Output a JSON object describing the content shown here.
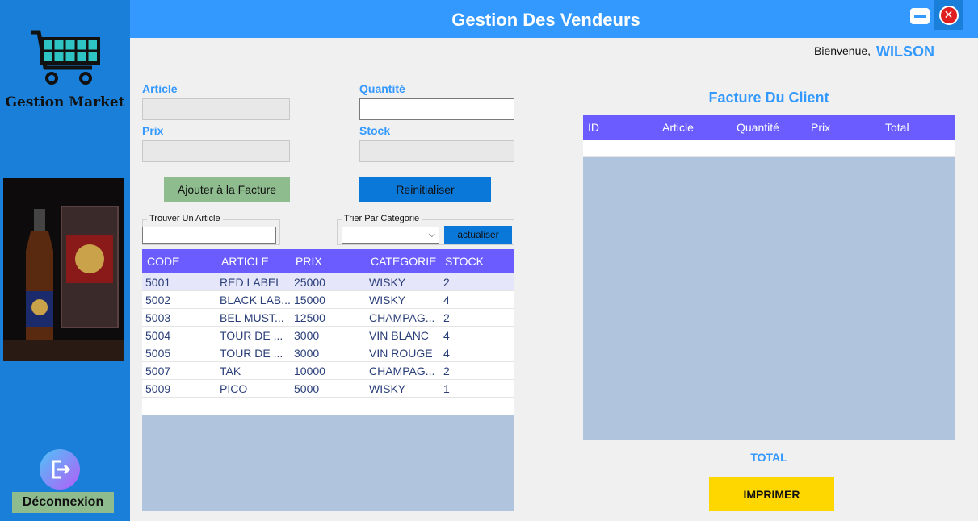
{
  "sidebar": {
    "logo_text": "Gestion Market",
    "logout_label": "Déconnexion",
    "logout_icon": "logout-icon",
    "promo_image": "bottle-image"
  },
  "header": {
    "title": "Gestion Des Vendeurs",
    "minimize_icon": "minimize-icon",
    "close_icon": "close-icon"
  },
  "welcome": {
    "prefix": "Bienvenue,",
    "name": "WILSON"
  },
  "form": {
    "article_label": "Article",
    "article_value": "",
    "quantity_label": "Quantité",
    "quantity_value": "",
    "price_label": "Prix",
    "price_value": "",
    "stock_label": "Stock",
    "stock_value": "",
    "add_button": "Ajouter à la Facture",
    "reset_button": "Reinitialiser"
  },
  "search": {
    "group_title": "Trouver Un Article",
    "value": ""
  },
  "filter": {
    "group_title": "Trier Par Categorie",
    "selected": "",
    "refresh_button": "actualiser"
  },
  "products": {
    "columns": [
      "CODE",
      "ARTICLE",
      "PRIX",
      "CATEGORIE",
      "STOCK"
    ],
    "rows": [
      [
        "5001",
        "RED LABEL",
        "25000",
        "WISKY",
        "2"
      ],
      [
        "5002",
        "BLACK LAB...",
        "15000",
        "WISKY",
        "4"
      ],
      [
        "5003",
        "BEL MUST...",
        "12500",
        "CHAMPAG...",
        "2"
      ],
      [
        "5004",
        "TOUR DE ...",
        "3000",
        "VIN BLANC",
        "4"
      ],
      [
        "5005",
        "TOUR DE ...",
        "3000",
        "VIN ROUGE",
        "4"
      ],
      [
        "5007",
        "TAK",
        "10000",
        "CHAMPAG...",
        "2"
      ],
      [
        "5009",
        "PICO",
        "5000",
        "WISKY",
        "1"
      ]
    ],
    "selected_row": 0
  },
  "invoice": {
    "title": "Facture Du Client",
    "columns": [
      "ID",
      "Article",
      "Quantité",
      "Prix",
      "Total"
    ],
    "rows": [],
    "total_label": "TOTAL",
    "print_button": "IMPRIMER"
  },
  "colors": {
    "sidebar": "#1a7fd8",
    "header": "#3399ff",
    "grid_header": "#6a5cff",
    "grid_bg": "#b0c4de",
    "print_button": "#ffd700",
    "green_button": "#8fbc8f"
  }
}
